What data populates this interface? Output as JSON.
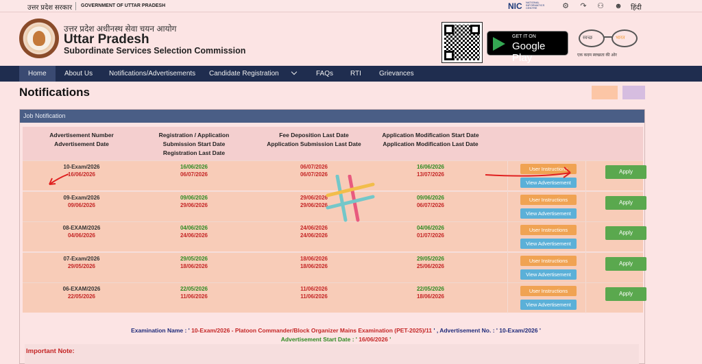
{
  "topbar": {
    "gov_hindi": "उत्तर प्रदेश सरकार",
    "gov_english": "GOVERNMENT OF UTTAR PRADESH",
    "nic": "NIC",
    "nic_sub": "NATIONAL INFORMATICS CENTRE",
    "lang_hindi": "हिंदी",
    "icons": [
      "settings-icon",
      "screen-reader-icon",
      "accessibility-icon",
      "user-icon"
    ]
  },
  "header": {
    "title_hindi": "उत्तर प्रदेश अधीनस्थ सेवा चयन आयोग",
    "title": "Uttar Pradesh",
    "subtitle": "Subordinate Services Selection Commission",
    "play_line1": "GET IT ON",
    "play_line2": "Google Play",
    "swachh_1": "स्वच्छ",
    "swachh_2": "भारत",
    "swachh_tagline": "एक कदम स्वच्छता की ओर"
  },
  "nav": {
    "items": [
      "Home",
      "About Us",
      "Notifications/Advertisements",
      "Candidate Registration",
      "FAQs",
      "RTI",
      "Grievances"
    ],
    "active": "Home"
  },
  "page": {
    "title": "Notifications"
  },
  "panel": {
    "title": "Job Notification",
    "headers": [
      [
        "Advertisement Number",
        "Advertisement Date"
      ],
      [
        "Registration / Application",
        "Submission  Start Date",
        "Registration Last Date"
      ],
      [
        "Fee Deposition Last Date",
        "Application Submission Last Date"
      ],
      [
        "Application Modification Start Date",
        "Application Modification Last Date"
      ]
    ],
    "buttons": {
      "user_instructions": "User Instructions",
      "view_advertisement": "View Advertisement",
      "apply": "Apply"
    },
    "rows": [
      {
        "adv_no": "10-Exam/2026",
        "adv_date": "16/06/2026",
        "reg_start": "16/06/2026",
        "reg_last": "06/07/2026",
        "fee_last": "06/07/2026",
        "sub_last": "06/07/2026",
        "mod_start": "16/06/2026",
        "mod_last": "13/07/2026"
      },
      {
        "adv_no": "09-Exam/2026",
        "adv_date": "09/06/2026",
        "reg_start": "09/06/2026",
        "reg_last": "29/06/2026",
        "fee_last": "29/06/2026",
        "sub_last": "29/06/2026",
        "mod_start": "09/06/2026",
        "mod_last": "06/07/2026"
      },
      {
        "adv_no": "08-EXAM/2026",
        "adv_date": "04/06/2026",
        "reg_start": "04/06/2026",
        "reg_last": "24/06/2026",
        "fee_last": "24/06/2026",
        "sub_last": "24/06/2026",
        "mod_start": "04/06/2026",
        "mod_last": "01/07/2026"
      },
      {
        "adv_no": "07-Exam/2026",
        "adv_date": "29/05/2026",
        "reg_start": "29/05/2026",
        "reg_last": "18/06/2026",
        "fee_last": "18/06/2026",
        "sub_last": "18/06/2026",
        "mod_start": "29/05/2026",
        "mod_last": "25/06/2026"
      },
      {
        "adv_no": "06-EXAM/2026",
        "adv_date": "22/05/2026",
        "reg_start": "22/05/2026",
        "reg_last": "11/06/2026",
        "fee_last": "11/06/2026",
        "sub_last": "11/06/2026",
        "mod_start": "22/05/2026",
        "mod_last": "18/06/2026"
      }
    ]
  },
  "exam_info": {
    "label_name": "Examination Name : '",
    "name": " 10-Exam/2026 - Platoon Commander/Block Organizer Mains Examination (PET-2025)/11 ",
    "label_adv": "' , Advertisement No. : '",
    "adv_no": " 10-Exam/2026 ",
    "label_close": "'",
    "label_start": "Advertisement Start Date : '",
    "start_date": " 16/06/2026 ",
    "label_start_close": "'"
  },
  "important": {
    "label": "Important Note:"
  },
  "colors": {
    "nav_bg": "#1f2d4f",
    "panel_head": "#4a5e86",
    "row_bg": "#f8ccb8",
    "orange_btn": "#f0a353",
    "blue_btn": "#5bb0d8",
    "green_btn": "#5aa84e",
    "red_text": "#c42525",
    "green_text": "#2e8a22",
    "annotation": "#e02020"
  }
}
